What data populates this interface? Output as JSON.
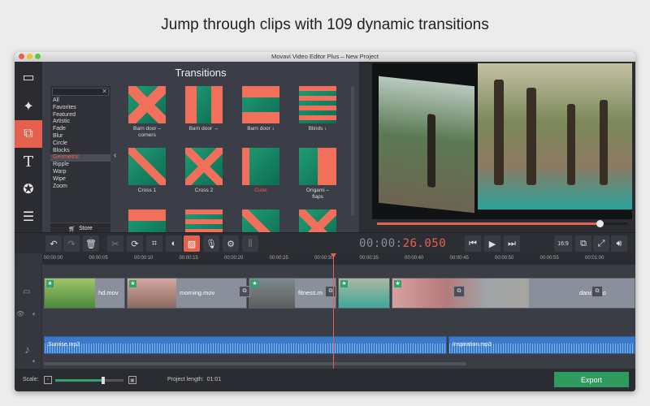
{
  "headline": "Jump through clips with 109 dynamic transitions",
  "window": {
    "title": "Movavi Video Editor Plus – New Project"
  },
  "tools": [
    {
      "name": "import",
      "icon": "film-icon"
    },
    {
      "name": "filters",
      "icon": "magic-wand-icon"
    },
    {
      "name": "transitions",
      "icon": "transition-icon",
      "active": true
    },
    {
      "name": "titles",
      "icon": "text-icon"
    },
    {
      "name": "stickers",
      "icon": "star-icon"
    },
    {
      "name": "more",
      "icon": "list-icon"
    }
  ],
  "transitions": {
    "title": "Transitions",
    "categories": [
      "All",
      "Favorites",
      "Featured",
      "Artistic",
      "Fade",
      "Blur",
      "Circle",
      "Blocks",
      "Geometric",
      "Ripple",
      "Warp",
      "Wipe",
      "Zoom"
    ],
    "selected_category": "Geometric",
    "store_label": "Store",
    "items": [
      {
        "label": "Barn door – corners",
        "l1": "Barn door –",
        "l2": "corners"
      },
      {
        "label": "Barn door ↔",
        "l1": "Barn door ↔",
        "l2": ""
      },
      {
        "label": "Barn door ↕",
        "l1": "Barn door ↕",
        "l2": ""
      },
      {
        "label": "Blinds ↓",
        "l1": "Blinds ↓",
        "l2": ""
      },
      {
        "label": "Cross 1",
        "l1": "Cross 1",
        "l2": ""
      },
      {
        "label": "Cross 2",
        "l1": "Cross 2",
        "l2": ""
      },
      {
        "label": "Cube",
        "l1": "Cube",
        "l2": "",
        "highlight": true
      },
      {
        "label": "Origami – flaps",
        "l1": "Origami –",
        "l2": "flaps"
      }
    ]
  },
  "preview": {
    "progress": 0.89
  },
  "toolbar": {
    "timecode_static": "00:00:",
    "timecode_live": "26.050",
    "aspect_ratio": "16:9"
  },
  "ruler": [
    "00:00:00",
    "00:00:05",
    "00:00:10",
    "00:00:15",
    "00:00:20",
    "00:00:25",
    "00:00:30",
    "00:00:35",
    "00:00:40",
    "00:00:45",
    "00:00:50",
    "00:00:55",
    "00:01:00"
  ],
  "video_clips": [
    {
      "name": "hd.mov"
    },
    {
      "name": "morning.mov"
    },
    {
      "name": "fitness.m"
    },
    {
      "name": ""
    },
    {
      "name": "dance.mo"
    }
  ],
  "audio_clips": [
    {
      "name": "Sunrise.mp3"
    },
    {
      "name": "Inspiration.mp3"
    }
  ],
  "footer": {
    "scale_label": "Scale:",
    "scale_value": 0.7,
    "project_length_label": "Project length:",
    "project_length": "01:01",
    "export_label": "Export"
  },
  "colors": {
    "accent": "#e4614f",
    "export": "#2e9a5e",
    "audio": "#3b79c9"
  }
}
